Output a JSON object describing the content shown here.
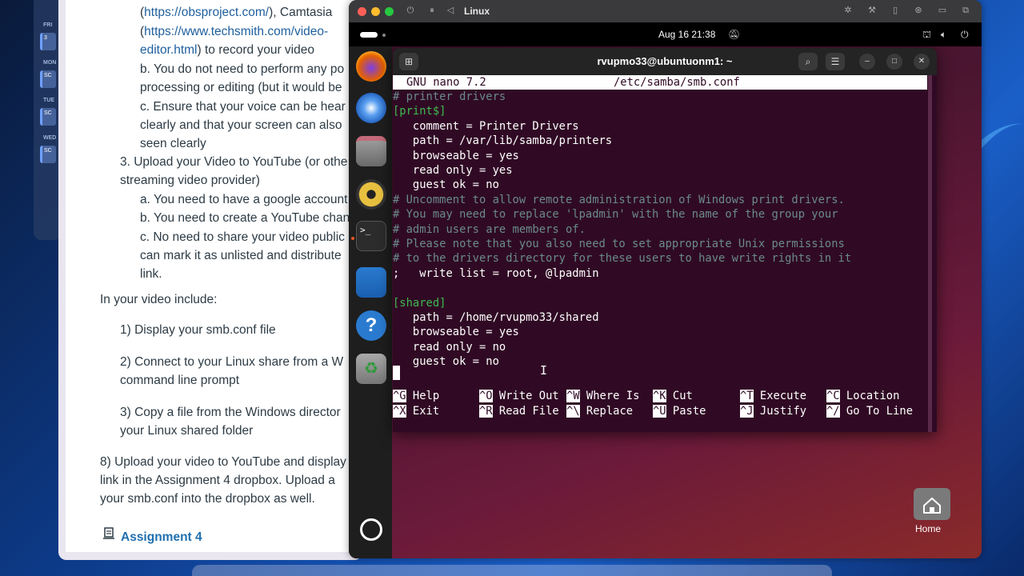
{
  "document": {
    "lines": [
      "(https://obsproject.com/), Camtasia",
      "(https://www.techsmith.com/video-",
      "editor.html) to record your video",
      "b. You do not need to perform any po",
      "processing or editing (but it would be",
      "c. Ensure that your voice can be hear",
      "clearly and that your screen can also",
      "seen clearly",
      "3. Upload your Video to YouTube (or othe",
      "streaming video provider)",
      "a. You need to have a google account",
      "b. You need to create a YouTube chan",
      "c. No need to share your video public",
      "can mark it as unlisted and distribute",
      "link.",
      "In your video include:",
      "1) Display your smb.conf file",
      "2) Connect to your Linux share from a W",
      "command line prompt",
      "3) Copy a file from the Windows director",
      "your Linux shared folder",
      "8) Upload your video to YouTube and display",
      "link in the Assignment 4 dropbox. Upload a",
      "your smb.conf into the dropbox as well."
    ],
    "link1": "https://obsproject.com/",
    "link2": "https://www.techsmith.com/video-",
    "link3": "editor.html",
    "assignment_link": "Assignment 4"
  },
  "calendar": {
    "labels": [
      "FRI",
      "MON",
      "TUE",
      "WED"
    ],
    "chip_texts": [
      "3",
      "SC",
      "SC",
      "SC"
    ]
  },
  "vm": {
    "title": "Linux",
    "clock": "Aug 16  21:38",
    "terminal_title": "rvupmo33@ubuntuonm1: ~",
    "home_label": "Home"
  },
  "nano": {
    "header_left": "GNU nano 7.2",
    "header_file": "/etc/samba/smb.conf",
    "lines": [
      {
        "text": "# printer drivers",
        "type": "comment"
      },
      {
        "text": "[print$]",
        "type": "section"
      },
      {
        "text": "   comment = Printer Drivers",
        "type": "key"
      },
      {
        "text": "   path = /var/lib/samba/printers",
        "type": "key"
      },
      {
        "text": "   browseable = yes",
        "type": "key"
      },
      {
        "text": "   read only = yes",
        "type": "key"
      },
      {
        "text": "   guest ok = no",
        "type": "key"
      },
      {
        "text": "# Uncomment to allow remote administration of Windows print drivers.",
        "type": "comment"
      },
      {
        "text": "# You may need to replace 'lpadmin' with the name of the group your",
        "type": "comment"
      },
      {
        "text": "# admin users are members of.",
        "type": "comment"
      },
      {
        "text": "# Please note that you also need to set appropriate Unix permissions",
        "type": "comment"
      },
      {
        "text": "# to the drivers directory for these users to have write rights in it",
        "type": "comment"
      },
      {
        "text": ";   write list = root, @lpadmin",
        "type": "key"
      },
      {
        "text": "",
        "type": "key"
      },
      {
        "text": "[shared]",
        "type": "section"
      },
      {
        "text": "   path = /home/rvupmo33/shared",
        "type": "key"
      },
      {
        "text": "   browseable = yes",
        "type": "key"
      },
      {
        "text": "   read only = no",
        "type": "key"
      },
      {
        "text": "   guest ok = no",
        "type": "key"
      }
    ],
    "shortcuts": [
      {
        "key": "^G",
        "label": "Help"
      },
      {
        "key": "^O",
        "label": "Write Out"
      },
      {
        "key": "^W",
        "label": "Where Is"
      },
      {
        "key": "^K",
        "label": "Cut"
      },
      {
        "key": "^T",
        "label": "Execute"
      },
      {
        "key": "^C",
        "label": "Location"
      },
      {
        "key": "^X",
        "label": "Exit"
      },
      {
        "key": "^R",
        "label": "Read File"
      },
      {
        "key": "^\\",
        "label": "Replace"
      },
      {
        "key": "^U",
        "label": "Paste"
      },
      {
        "key": "^J",
        "label": "Justify"
      },
      {
        "key": "^/",
        "label": "Go To Line"
      }
    ]
  },
  "colors": {
    "terminal_bg": "#300a24",
    "comment": "#6a8a8a",
    "section": "#3fb950",
    "link": "#1f5f9e"
  }
}
